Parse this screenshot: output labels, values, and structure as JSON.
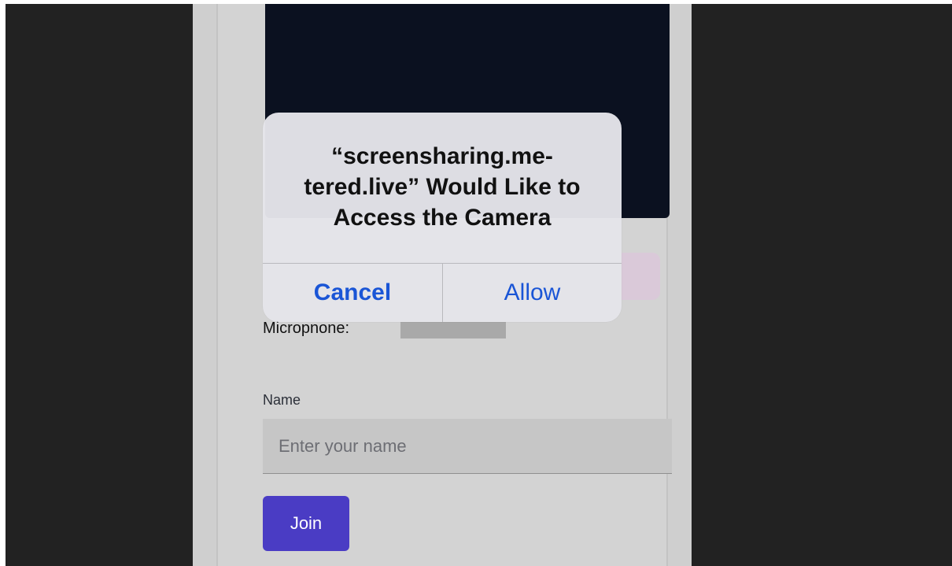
{
  "alert": {
    "title": "“screensharing.me-\ntered.live” Would Like to\nAccess the Camera",
    "cancel_label": "Cancel",
    "allow_label": "Allow"
  },
  "form": {
    "microphone_label": "Micropnone:",
    "name_label": "Name",
    "name_value": "",
    "name_placeholder": "Enter your name",
    "join_label": "Join"
  },
  "colors": {
    "accent": "#4a3cc4",
    "alert_button": "#1a55d6",
    "video_background": "#0b1120",
    "outer_background": "#222222"
  }
}
